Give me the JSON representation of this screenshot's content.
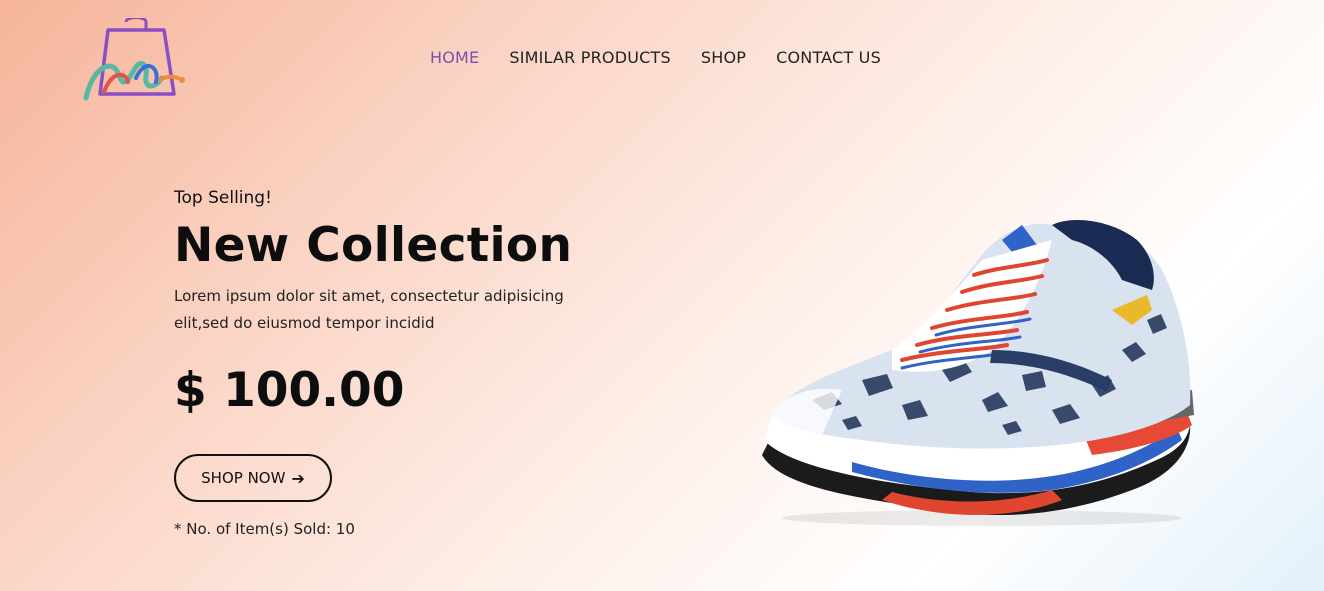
{
  "nav": {
    "items": [
      {
        "label": "HOME",
        "active": true
      },
      {
        "label": "SIMILAR PRODUCTS",
        "active": false
      },
      {
        "label": "SHOP",
        "active": false
      },
      {
        "label": "CONTACT US",
        "active": false
      }
    ],
    "active_color": "#7a4fb0"
  },
  "hero": {
    "kicker": "Top Selling!",
    "title": "New Collection",
    "description": "Lorem ipsum dolor sit amet, consectetur adipisicing elit,sed do eiusmod tempor incidid",
    "price": "$ 100.00",
    "shop_button": "SHOP NOW",
    "shop_button_icon": "arrow-right-icon",
    "sold_text": "* No. of Item(s) Sold: 10"
  },
  "logo": {
    "icon": "shopping-bag-logo",
    "brand_color": "#8a4fc4"
  }
}
